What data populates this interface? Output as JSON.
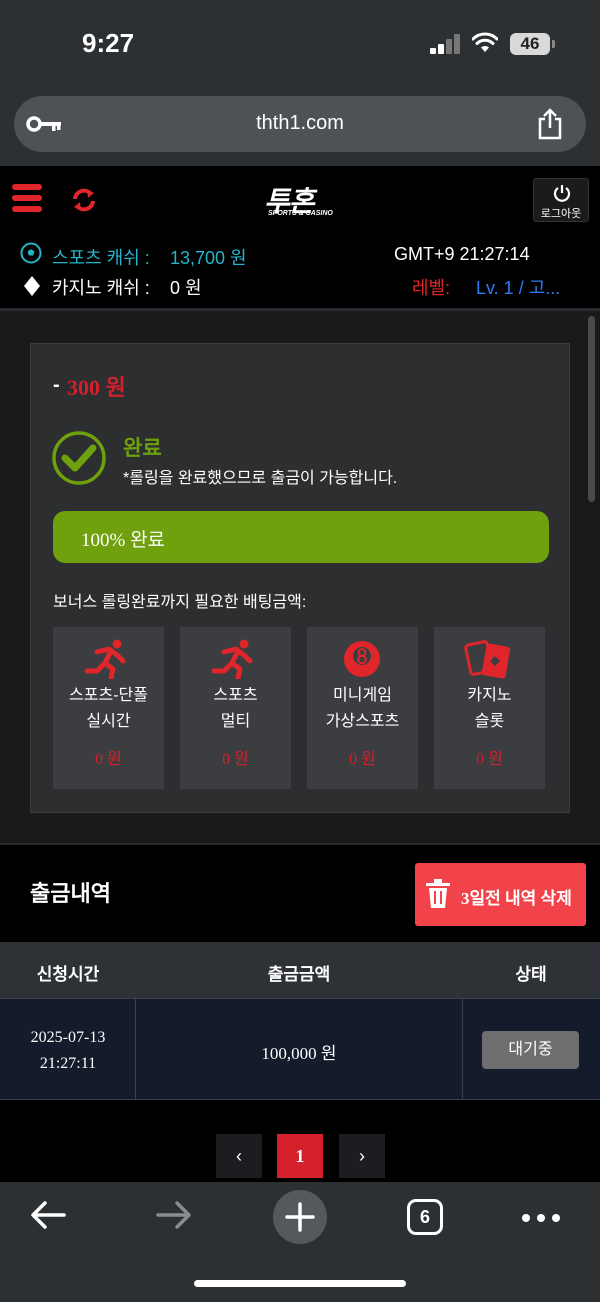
{
  "status_bar": {
    "time": "9:27",
    "battery": "46"
  },
  "browser": {
    "url": "thth1.com",
    "tab_count": "6"
  },
  "header": {
    "logo_text": "투혼",
    "logo_sub": "SPORTS & CASINO",
    "logout_label": "로그아웃"
  },
  "balance": {
    "sports_label": "스포츠 캐쉬 :",
    "sports_value": "13,700 원",
    "casino_label": "카지노 캐쉬 :",
    "casino_value": "0 원",
    "gmt": "GMT+9 21:27:14",
    "level_label": "레벨:",
    "level_value": "Lv. 1 / 고..."
  },
  "rolling": {
    "amount_prefix": "-",
    "amount": "300 원",
    "done_title": "완료",
    "done_message": "*롤링을 완료했으므로 출금이 가능합니다.",
    "progress_percent": 100,
    "progress_text": "100% 완료",
    "needed_label": "보너스 롤링완료까지 필요한 배팅금액:",
    "tiles": [
      {
        "icon": "runner-icon",
        "line1": "스포츠-단폴",
        "line2": "실시간",
        "value": "0 원"
      },
      {
        "icon": "runner-icon",
        "line1": "스포츠",
        "line2": "멀티",
        "value": "0 원"
      },
      {
        "icon": "billiard-ball-icon",
        "line1": "미니게임",
        "line2": "가상스포츠",
        "value": "0 원"
      },
      {
        "icon": "playing-cards-icon",
        "line1": "카지노",
        "line2": "슬롯",
        "value": "0 원"
      }
    ]
  },
  "history": {
    "title": "출금내역",
    "delete_label": "3일전 내역 삭제",
    "columns": [
      "신청시간",
      "출금금액",
      "상태"
    ],
    "rows": [
      {
        "date": "2025-07-13",
        "time": "21:27:11",
        "amount": "100,000 원",
        "status": "대기중"
      }
    ]
  },
  "pagination": {
    "prev": "‹",
    "current": "1",
    "next": "›"
  },
  "colors": {
    "accent_red": "#d4202a",
    "accent_green": "#6ea10d",
    "sports_cyan": "#27b3c9",
    "level_blue": "#2f7bf5"
  }
}
